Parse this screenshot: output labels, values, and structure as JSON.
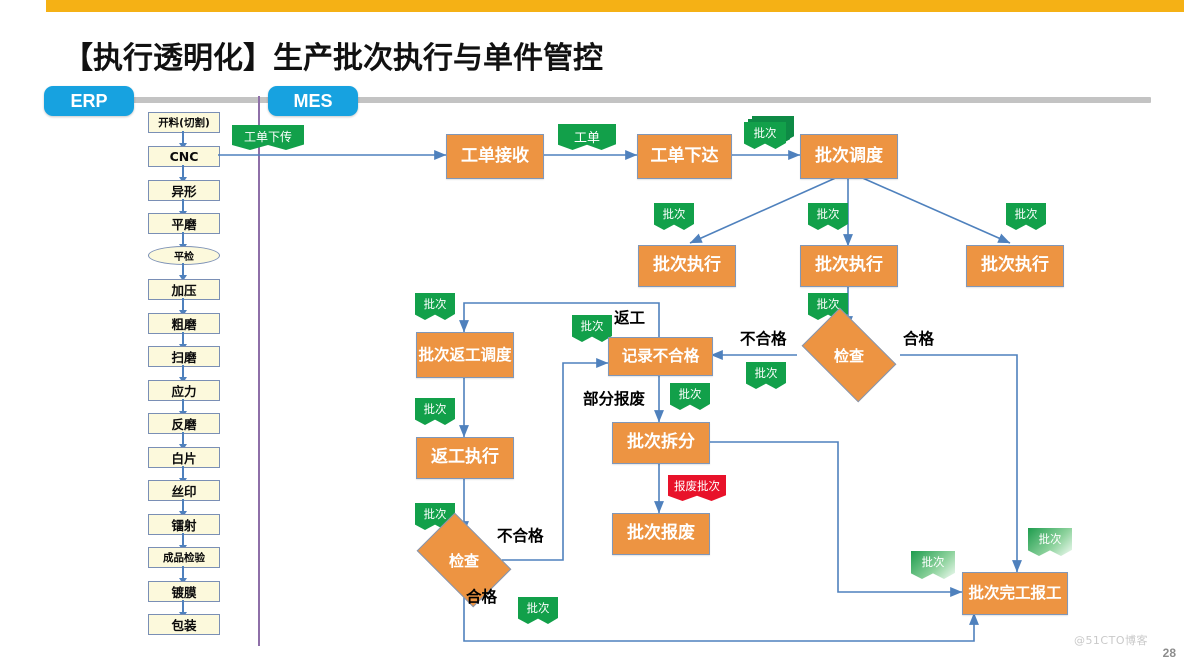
{
  "slide": {
    "title": "【执行透明化】生产批次执行与单件管控",
    "page_number": "28",
    "watermark": "@51CTO博客",
    "accent_bar_color": "#F5B115",
    "lane_pill_color": "#17A2E0",
    "process_box_color": "#ED9442",
    "tag_color": "#12A04A",
    "scrap_tag_color": "#E8122A",
    "connector_color": "#4F81BD",
    "erp_box_color": "#FCF9DC"
  },
  "lanes": {
    "erp": "ERP",
    "mes": "MES"
  },
  "erp_steps": [
    {
      "label": "开料(切割)",
      "shape": "rect"
    },
    {
      "label": "CNC",
      "shape": "rect"
    },
    {
      "label": "异形",
      "shape": "rect"
    },
    {
      "label": "平磨",
      "shape": "rect"
    },
    {
      "label": "平检",
      "shape": "oval"
    },
    {
      "label": "加压",
      "shape": "rect"
    },
    {
      "label": "粗磨",
      "shape": "rect"
    },
    {
      "label": "扫磨",
      "shape": "rect"
    },
    {
      "label": "应力",
      "shape": "rect"
    },
    {
      "label": "反磨",
      "shape": "rect"
    },
    {
      "label": "白片",
      "shape": "rect"
    },
    {
      "label": "丝印",
      "shape": "rect"
    },
    {
      "label": "镭射",
      "shape": "rect"
    },
    {
      "label": "成品检验",
      "shape": "rect"
    },
    {
      "label": "镀膜",
      "shape": "rect"
    },
    {
      "label": "包装",
      "shape": "rect"
    }
  ],
  "mes_nodes": [
    {
      "id": "receive",
      "label": "工单接收",
      "shape": "process"
    },
    {
      "id": "release",
      "label": "工单下达",
      "shape": "process"
    },
    {
      "id": "schedule",
      "label": "批次调度",
      "shape": "process"
    },
    {
      "id": "exec1",
      "label": "批次执行",
      "shape": "process"
    },
    {
      "id": "exec2",
      "label": "批次执行",
      "shape": "process"
    },
    {
      "id": "exec3",
      "label": "批次执行",
      "shape": "process"
    },
    {
      "id": "inspect1",
      "label": "检查",
      "shape": "decision"
    },
    {
      "id": "record-ng",
      "label": "记录不合格",
      "shape": "process"
    },
    {
      "id": "rework-sched",
      "label": "批次\n返工调度",
      "shape": "process"
    },
    {
      "id": "rework-exec",
      "label": "返工执行",
      "shape": "process"
    },
    {
      "id": "inspect2",
      "label": "检查",
      "shape": "decision"
    },
    {
      "id": "split",
      "label": "批次拆分",
      "shape": "process"
    },
    {
      "id": "scrap",
      "label": "批次报废",
      "shape": "process"
    },
    {
      "id": "finish",
      "label": "批次\n完工报工",
      "shape": "process"
    }
  ],
  "node_labels": {
    "receive": "工单接收",
    "release": "工单下达",
    "schedule": "批次调度",
    "exec1": "批次执行",
    "exec2": "批次执行",
    "exec3": "批次执行",
    "inspect1": "检查",
    "inspect2": "检查",
    "record_ng": "记录不合格",
    "rework_sched_line1": "批次",
    "rework_sched_line2": "返工调度",
    "rework_exec": "返工执行",
    "split": "批次拆分",
    "scrap": "批次报废",
    "finish_line1": "批次",
    "finish_line2": "完工报工"
  },
  "flow_tags": {
    "work_order_download": "工单下传",
    "work_order": "工单",
    "batch": "批次",
    "scrap_batch": "报废批次"
  },
  "edge_labels": {
    "rework": "返工",
    "ng": "不合格",
    "ok": "合格",
    "partial_scrap": "部分报废",
    "ng2": "不合格",
    "ok2": "合格"
  },
  "tag_instances": [
    {
      "name": "tag-work-order-download",
      "text": "工单下传"
    },
    {
      "name": "tag-work-order",
      "text": "工单"
    },
    {
      "name": "tag-batch-schedule",
      "text": "批次"
    },
    {
      "name": "tag-batch-exec1",
      "text": "批次"
    },
    {
      "name": "tag-batch-exec2",
      "text": "批次"
    },
    {
      "name": "tag-batch-exec3",
      "text": "批次"
    },
    {
      "name": "tag-batch-inspect1",
      "text": "批次"
    },
    {
      "name": "tag-batch-ng",
      "text": "批次"
    },
    {
      "name": "tag-batch-rework-sched",
      "text": "批次"
    },
    {
      "name": "tag-batch-record-ng",
      "text": "批次"
    },
    {
      "name": "tag-batch-rework-exec",
      "text": "批次"
    },
    {
      "name": "tag-batch-split",
      "text": "批次"
    },
    {
      "name": "tag-batch-inspect2",
      "text": "批次"
    },
    {
      "name": "tag-batch-ok2",
      "text": "批次"
    },
    {
      "name": "tag-scrap-batch",
      "text": "报废批次"
    },
    {
      "name": "tag-batch-finish-left",
      "text": "批次"
    },
    {
      "name": "tag-batch-finish-top",
      "text": "批次"
    }
  ]
}
